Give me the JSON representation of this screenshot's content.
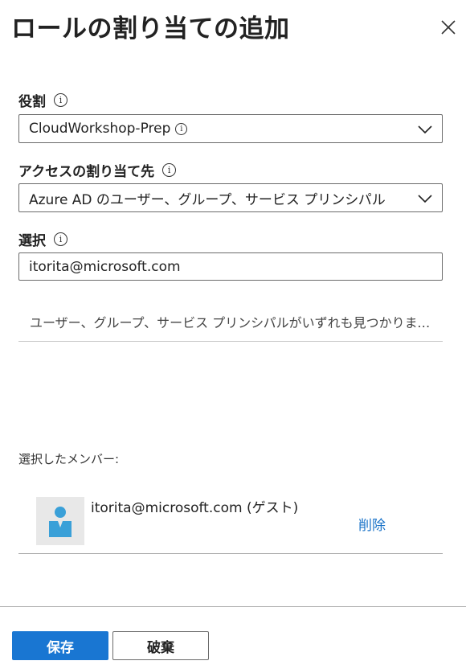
{
  "panel": {
    "title": "ロールの割り当ての追加",
    "close_icon": "close-icon"
  },
  "role": {
    "label": "役割",
    "info": "i",
    "selected": "CloudWorkshop-Prep",
    "selected_info": "i"
  },
  "assign_access": {
    "label": "アクセスの割り当て先",
    "info": "i",
    "selected": "Azure AD のユーザー、グループ、サービス プリンシパル"
  },
  "select": {
    "label": "選択",
    "info": "i",
    "value": "itorita@microsoft.com",
    "no_results": "ユーザー、グループ、サービス プリンシパルがいずれも見つかりません..."
  },
  "members": {
    "label": "選択したメンバー:",
    "items": [
      {
        "name": "itorita@microsoft.com (ゲスト)",
        "remove_label": "削除",
        "avatar_icon": "user-avatar-icon"
      }
    ]
  },
  "footer": {
    "save_label": "保存",
    "discard_label": "破棄"
  },
  "colors": {
    "accent": "#1976d2",
    "link": "#1a73c8",
    "avatar": "#3aa0d8"
  }
}
